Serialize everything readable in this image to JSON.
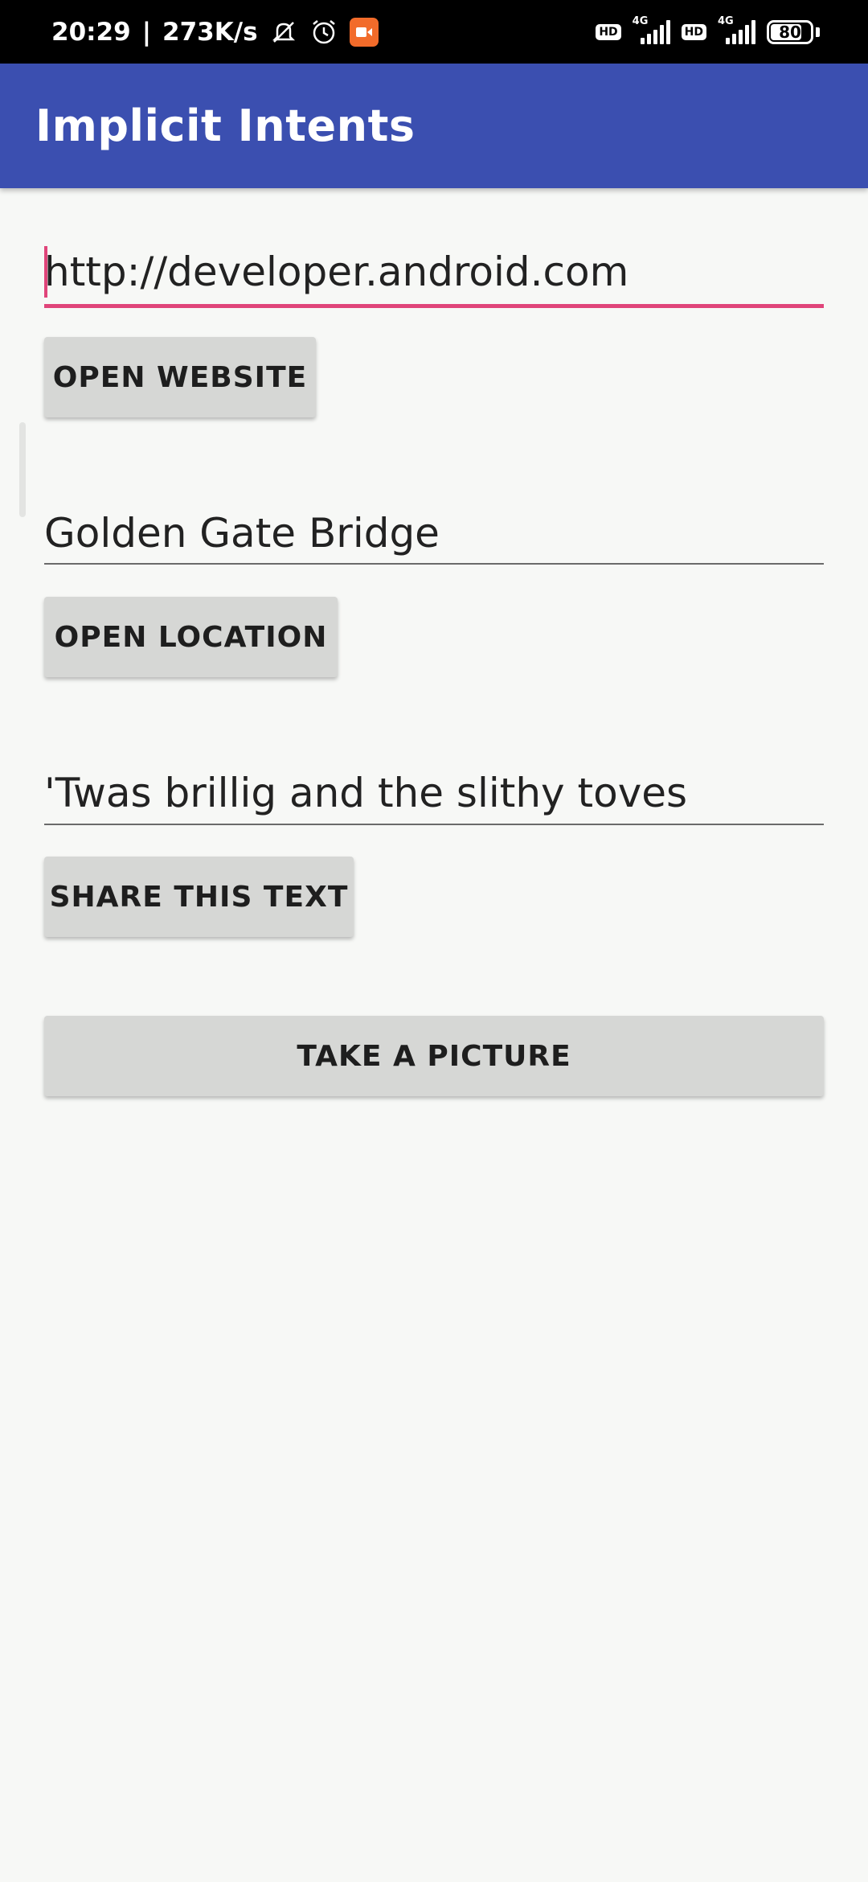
{
  "status_bar": {
    "time": "20:29",
    "separator": "|",
    "speed": "273K/s",
    "icons": [
      "mute-icon",
      "alarm-icon",
      "screen-record-icon"
    ],
    "sim1_badge": "HD",
    "sim1_network": "4G",
    "sim2_badge": "HD",
    "sim2_network": "4G",
    "battery": "80",
    "battery_level": 0.8
  },
  "app_bar": {
    "title": "Implicit Intents",
    "color": "#3b4fb0"
  },
  "website": {
    "value": "http://developer.android.com",
    "button_label": "OPEN WEBSITE"
  },
  "location": {
    "value": "Golden Gate Bridge",
    "button_label": "OPEN LOCATION"
  },
  "share": {
    "value": "'Twas brillig and the slithy toves",
    "button_label": "SHARE THIS TEXT"
  },
  "camera": {
    "button_label": "TAKE A PICTURE"
  },
  "colors": {
    "accent": "#e0457a",
    "button_bg": "#d6d7d5",
    "background": "#f7f8f6"
  }
}
